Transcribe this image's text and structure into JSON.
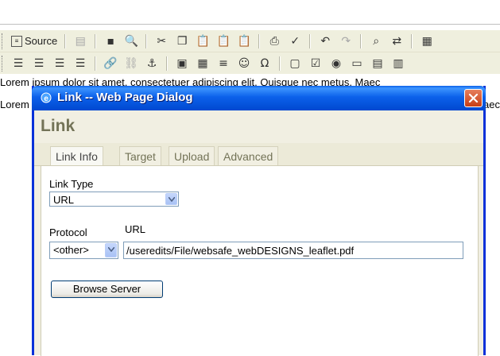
{
  "editor": {
    "toolbar1": {
      "source_label": "Source",
      "icons": [
        "templates-icon",
        "save-icon",
        "preview-icon",
        "cut-icon",
        "copy-icon",
        "paste-icon",
        "paste-text-icon",
        "paste-word-icon",
        "print-icon",
        "spellcheck-icon",
        "undo-icon",
        "redo-icon",
        "find-icon",
        "replace-icon",
        "select-all-icon"
      ]
    },
    "toolbar2": {
      "icons": [
        "align-left-icon",
        "align-center-icon",
        "align-right-icon",
        "justify-icon",
        "link-icon",
        "unlink-icon",
        "anchor-icon",
        "image-icon",
        "table-icon",
        "horizontal-rule-icon",
        "smiley-icon",
        "special-char-icon",
        "form-icon",
        "checkbox-icon",
        "radio-icon",
        "textfield-icon",
        "textarea-icon",
        "select-field-icon"
      ]
    },
    "content_line1": "Lorem ipsum dolor sit amet, consectetuer adipiscing elit. Quisque nec metus. Maec",
    "content_line2_left": "Lorem",
    "content_line2_right": "Maec"
  },
  "dialog": {
    "window_title": "Link -- Web Page Dialog",
    "heading": "Link",
    "tabs": [
      {
        "label": "Link Info",
        "active": true
      },
      {
        "label": "Target",
        "active": false
      },
      {
        "label": "Upload",
        "active": false
      },
      {
        "label": "Advanced",
        "active": false
      }
    ],
    "link_type_label": "Link Type",
    "link_type_value": "URL",
    "protocol_label": "Protocol",
    "protocol_value": "<other>",
    "url_label": "URL",
    "url_value": "/useredits/File/websafe_webDESIGNS_leaflet.pdf",
    "browse_label": "Browse Server"
  },
  "colors": {
    "titlebar": "#0048d0",
    "dialog_heading": "#737357",
    "close_button": "#c83d14"
  }
}
